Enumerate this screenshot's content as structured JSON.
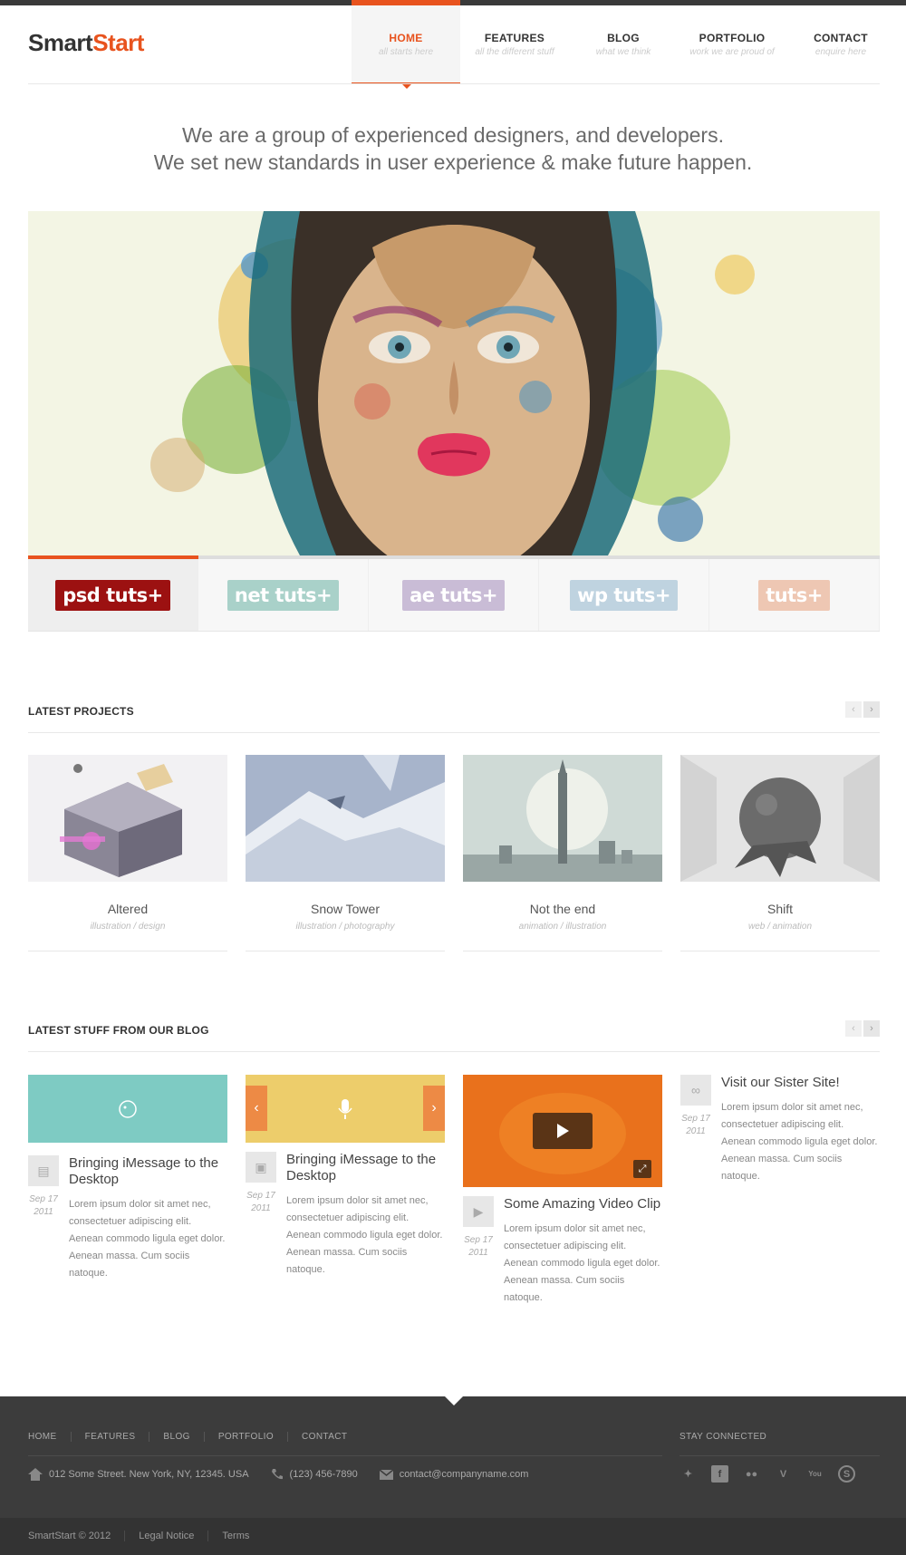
{
  "header": {
    "logo_part1": "Smart",
    "logo_part2": "Start",
    "nav": [
      {
        "label": "HOME",
        "sub": "all starts here"
      },
      {
        "label": "FEATURES",
        "sub": "all the different stuff"
      },
      {
        "label": "BLOG",
        "sub": "what we think"
      },
      {
        "label": "PORTFOLIO",
        "sub": "work we are proud of"
      },
      {
        "label": "CONTACT",
        "sub": "enquire here"
      }
    ]
  },
  "tagline": {
    "line1": "We are a group of experienced designers, and developers.",
    "line2": "We set new standards in user experience & make future happen."
  },
  "slider": {
    "thumbs": [
      {
        "prefix": "psd",
        "suffix": "tuts+",
        "color": "#9c1111"
      },
      {
        "prefix": "net",
        "suffix": "tuts+",
        "color": "#a9d1c9"
      },
      {
        "prefix": "ae",
        "suffix": "tuts+",
        "color": "#c9bcd6"
      },
      {
        "prefix": "wp",
        "suffix": "tuts+",
        "color": "#bfd3e0"
      },
      {
        "prefix": "",
        "suffix": "tuts+",
        "color": "#eec7b3"
      }
    ]
  },
  "projects": {
    "title": "LATEST PROJECTS",
    "prev": "‹",
    "next": "›",
    "items": [
      {
        "title": "Altered",
        "category": "illustration / design"
      },
      {
        "title": "Snow Tower",
        "category": "illustration / photography"
      },
      {
        "title": "Not the end",
        "category": "animation / illustration"
      },
      {
        "title": "Shift",
        "category": "web / animation"
      }
    ]
  },
  "blog": {
    "title": "LATEST STUFF FROM OUR BLOG",
    "prev": "‹",
    "next": "›",
    "posts": [
      {
        "title": "Bringing iMessage to the Desktop",
        "date_day": "Sep 17",
        "date_year": "2011",
        "text": "Lorem ipsum dolor sit amet nec, consectetuer adipiscing elit. Aenean commodo ligula eget dolor. Aenean massa. Cum sociis natoque."
      },
      {
        "title": "Bringing iMessage to the Desktop",
        "date_day": "Sep 17",
        "date_year": "2011",
        "text": "Lorem ipsum dolor sit amet nec, consectetuer adipiscing elit. Aenean commodo ligula eget dolor. Aenean massa. Cum sociis natoque."
      },
      {
        "title": "Some Amazing Video Clip",
        "date_day": "Sep 17",
        "date_year": "2011",
        "text": "Lorem ipsum dolor sit amet nec, consectetuer adipiscing elit. Aenean commodo ligula eget dolor. Aenean massa. Cum sociis natoque."
      },
      {
        "title": "Visit our Sister Site!",
        "date_day": "Sep 17",
        "date_year": "2011",
        "text": "Lorem ipsum dolor sit amet nec, consectetuer adipiscing elit. Aenean commodo ligula eget dolor. Aenean massa. Cum sociis natoque."
      }
    ]
  },
  "footer": {
    "nav": [
      "HOME",
      "FEATURES",
      "BLOG",
      "PORTFOLIO",
      "CONTACT"
    ],
    "stay_connected": "STAY CONNECTED",
    "address": "012 Some Street. New York, NY, 12345. USA",
    "phone": "(123) 456-7890",
    "email": "contact@companyname.com",
    "socials": [
      "twitter-icon",
      "facebook-icon",
      "flickr-icon",
      "vimeo-icon",
      "youtube-icon",
      "skype-icon"
    ],
    "copyright": "SmartStart © 2012",
    "legal": "Legal Notice",
    "terms": "Terms"
  },
  "colors": {
    "accent": "#e8531e",
    "footer_bg": "#3c3c3c"
  }
}
